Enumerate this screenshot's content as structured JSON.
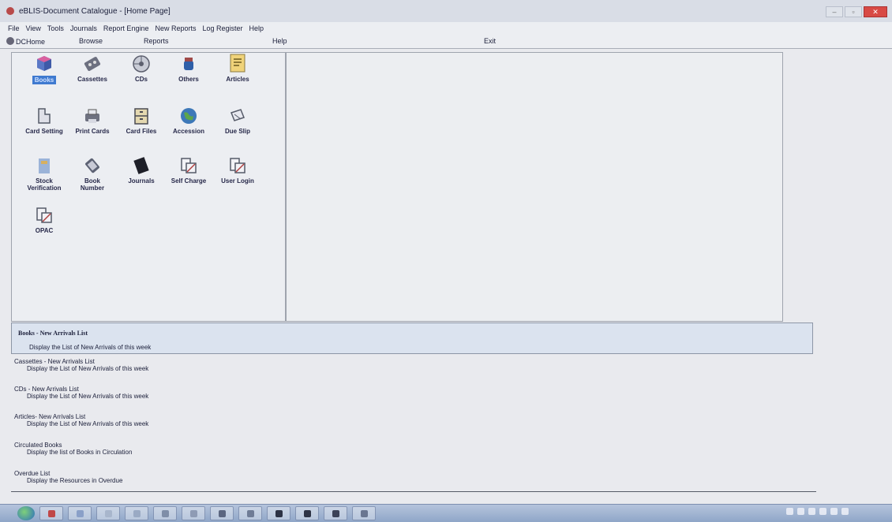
{
  "window": {
    "title": "eBLIS-Document Catalogue - [Home Page]",
    "minimize": "–",
    "restore": "▫",
    "close": "✕"
  },
  "menu": [
    "File",
    "View",
    "Tools",
    "Journals",
    "Report Engine",
    "New Reports",
    "Log Register",
    "Help"
  ],
  "toolbar": {
    "home": "DCHome",
    "browse": "Browse",
    "reports": "Reports",
    "help": "Help",
    "exit": "Exit"
  },
  "icons": {
    "books": "Books",
    "cassettes": "Cassettes",
    "cds": "CDs",
    "others": "Others",
    "articles": "Articles",
    "card_setting": "Card Setting",
    "print_cards": "Print Cards",
    "card_files": "Card Files",
    "accession": "Accession",
    "due_slip": "Due Slip",
    "stock_verification_1": "Stock",
    "stock_verification_2": "Verification",
    "book_number_1": "Book",
    "book_number_2": "Number",
    "journals": "Journals",
    "self_charge": "Self Charge",
    "user_login": "User Login",
    "opac": "OPAC"
  },
  "reports": [
    {
      "title": "Books - New Arrivals List",
      "desc": "Display the List of New Arrivals of this week"
    },
    {
      "title": "Cassettes - New Arrivals List",
      "desc": "Display the List of New Arrivals of this week"
    },
    {
      "title": "CDs - New Arrivals List",
      "desc": "Display the List of New Arrivals of this week"
    },
    {
      "title": "Articles- New Arrivals List",
      "desc": "Display the List of New Arrivals of this week"
    },
    {
      "title": "Circulated Books",
      "desc": "Display the list of Books in Circulation"
    },
    {
      "title": "Overdue List",
      "desc": "Display the Resources in Overdue"
    }
  ],
  "colors": {
    "selected_label": "#3f7ad0",
    "taskbar": "#8fa6c8"
  }
}
